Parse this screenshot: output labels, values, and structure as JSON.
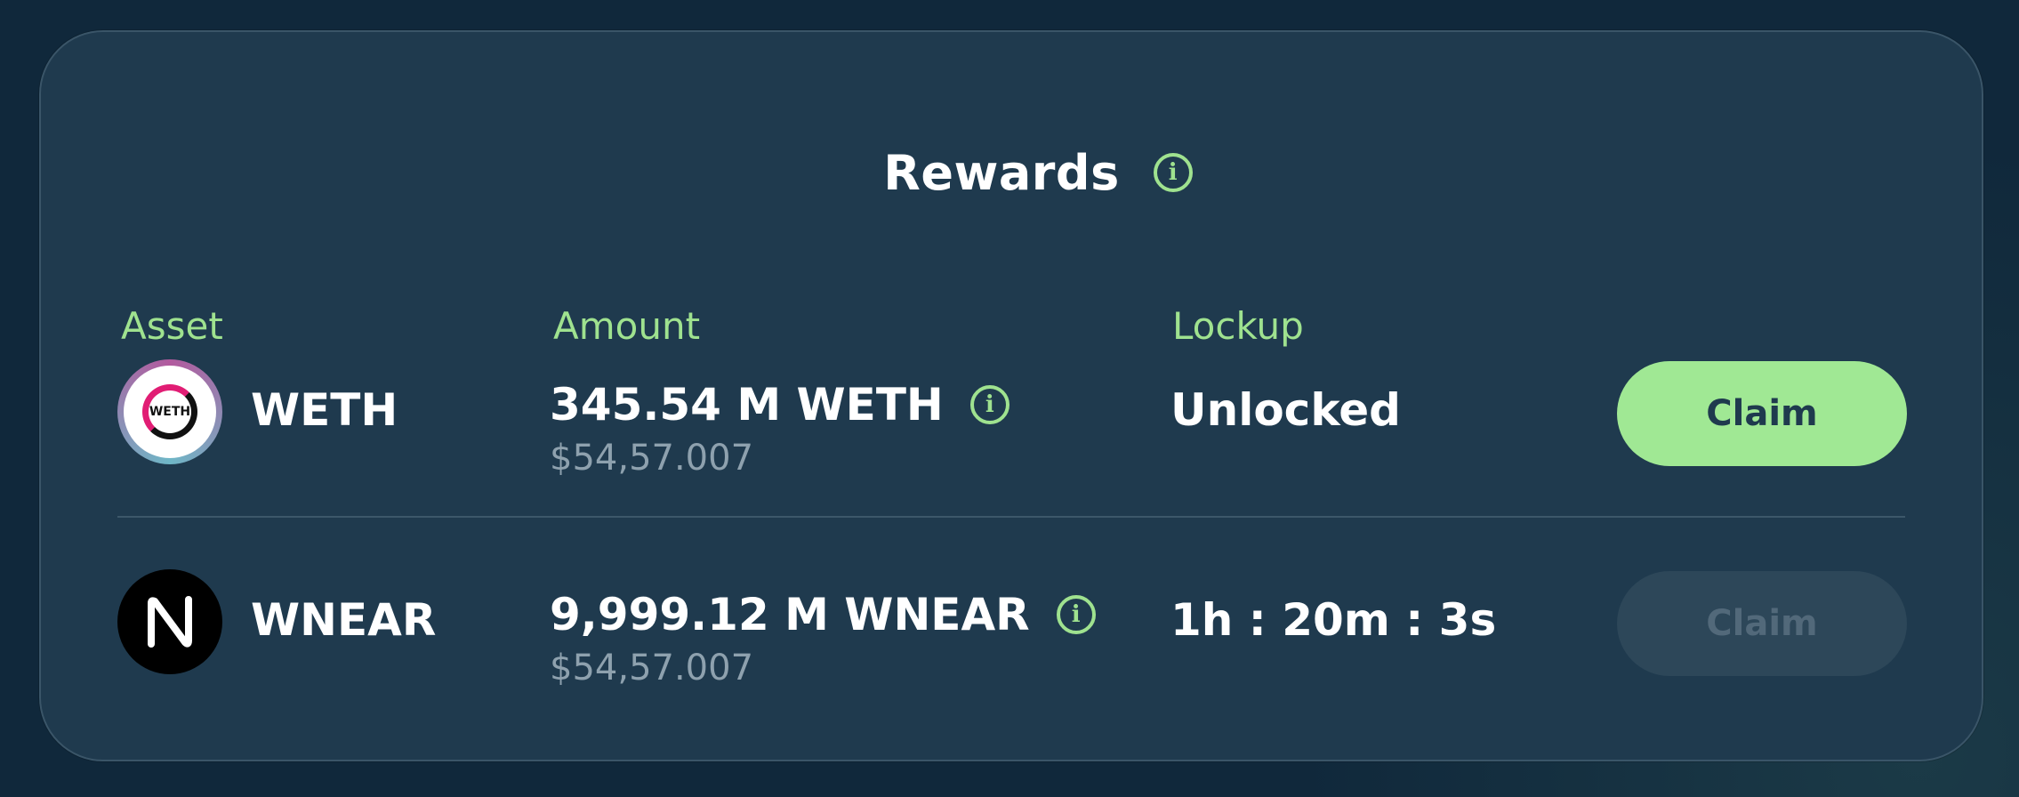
{
  "header": {
    "title": "Rewards",
    "info_icon": "info-icon"
  },
  "columns": {
    "asset": "Asset",
    "amount": "Amount",
    "lockup": "Lockup"
  },
  "rows": [
    {
      "asset": "WETH",
      "logo": "weth-logo",
      "logo_text": "WETH",
      "amount": "345.54 M WETH",
      "usd": "$54,57.007",
      "lockup": "Unlocked",
      "button": "Claim",
      "button_state": "active"
    },
    {
      "asset": "WNEAR",
      "logo": "near-logo",
      "amount": "9,999.12 M WNEAR",
      "usd": "$54,57.007",
      "lockup": "1h : 20m : 3s",
      "button": "Claim",
      "button_state": "disabled"
    }
  ],
  "colors": {
    "accent": "#9fe28f",
    "card_bg": "#1f3a4e",
    "page_bg": "#10283b",
    "button_active": "#a0e894",
    "button_disabled": "#2d4759"
  }
}
